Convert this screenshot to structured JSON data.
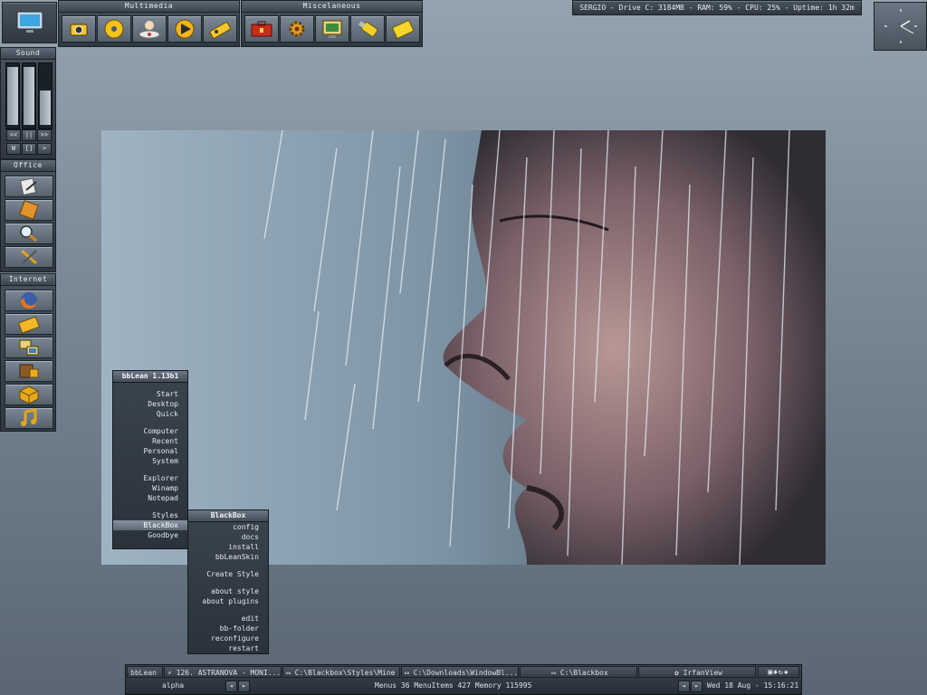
{
  "panels": {
    "multimedia_title": "Multimedia",
    "misc_title": "Miscelaneous",
    "sound_title": "Sound",
    "office_title": "Office",
    "internet_title": "Internet",
    "sound_transport": [
      "<<",
      "||",
      ">>"
    ],
    "sound_bottom": [
      "W",
      "[]",
      ">"
    ]
  },
  "system_monitor": "SERGIO - Drive C: 3184MB - RAM: 59% - CPU: 25% - Uptime: 1h 32m",
  "bblean_menu": {
    "title": "bbLean 1.13b1",
    "groups": [
      [
        "Start",
        "Desktop",
        "Quick"
      ],
      [
        "Computer",
        "Recent",
        "Personal",
        "System"
      ],
      [
        "Explorer",
        "Winamp",
        "Notepad"
      ],
      [
        "Styles",
        "BlackBox",
        "Goodbye"
      ]
    ],
    "selected": "BlackBox"
  },
  "blackbox_menu": {
    "title": "BlackBox",
    "groups": [
      [
        "config",
        "docs",
        "install",
        "bbLeanSkin"
      ],
      [
        "Create Style"
      ],
      [
        "about style",
        "about plugins"
      ],
      [
        "edit",
        "bb-folder",
        "reconfigure",
        "restart"
      ]
    ]
  },
  "taskbar": {
    "workspace_label": "bbLean",
    "tasks": [
      "126. ASTRANOVA - MONI...",
      "C:\\Blackbox\\Styles\\Mine",
      "C:\\Downloads\\WindowBl...",
      "C:\\Blackbox",
      "IrfanView"
    ],
    "workspace_name": "alpha",
    "stats": "Menus 36  MenuItems 427  Memory 115995",
    "clock": "Wed 18 Aug - 15:16:21"
  },
  "icons": {
    "multimedia": [
      "camera-icon",
      "cd-disc-icon",
      "cd-player-icon",
      "play-icon",
      "tape-edit-icon"
    ],
    "misc": [
      "toolbox-icon",
      "gear-tools-icon",
      "display-icon",
      "usb-drive-icon",
      "notepad-icon"
    ],
    "office": [
      "pen-document-icon",
      "book-icon",
      "magnifier-icon",
      "tools-icon"
    ],
    "internet": [
      "firefox-icon",
      "mail-icon",
      "network-icon",
      "ftp-icon",
      "package-icon",
      "music-note-icon"
    ]
  },
  "colors": {
    "accent_gold": "#e8b31a",
    "menu_bg": "#2f3842",
    "highlight": "#7f8c99"
  }
}
